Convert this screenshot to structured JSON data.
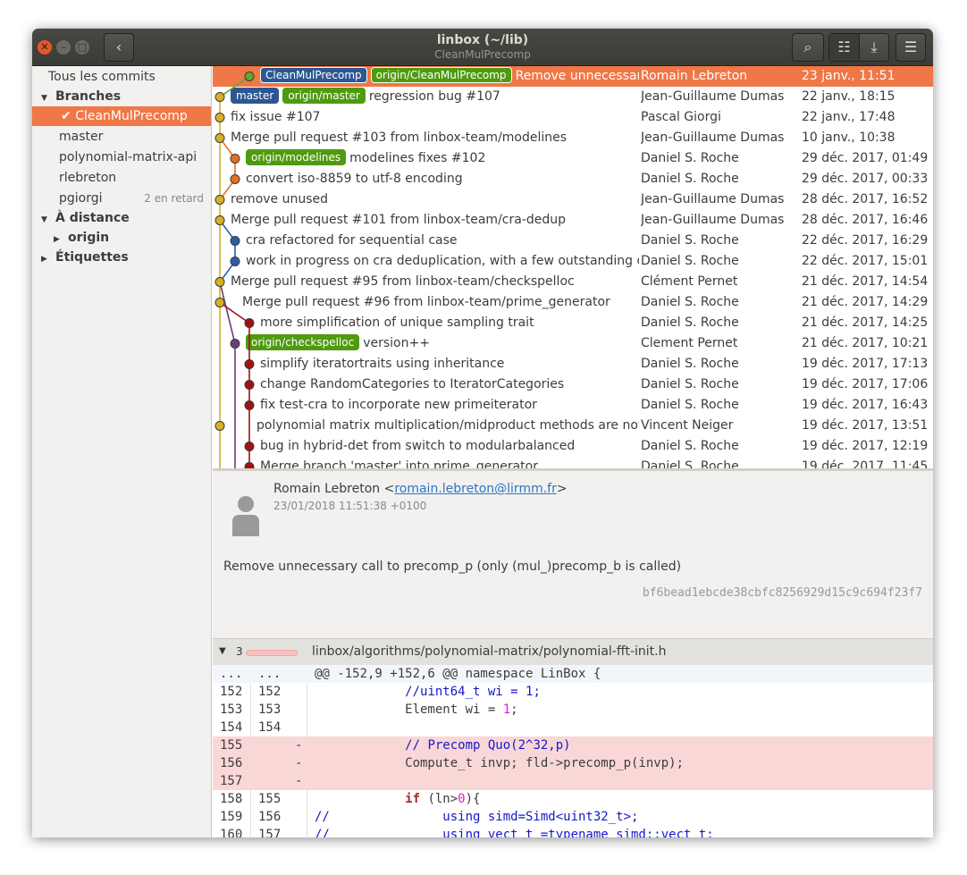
{
  "window": {
    "title": "linbox (~/lib)",
    "subtitle": "CleanMulPrecomp"
  },
  "header": {
    "back_icon": "‹",
    "search_icon": "⌕",
    "list_icon": "☷",
    "download_icon": "⤓",
    "menu_icon": "☰"
  },
  "window_controls": {
    "close": "✕",
    "minimize": "–",
    "maximize": "□"
  },
  "sidebar": {
    "all_commits": "Tous les commits",
    "branches_label": "Branches",
    "branches": [
      {
        "name": "CleanMulPrecomp",
        "check": "✔",
        "selected": true
      },
      {
        "name": "master"
      },
      {
        "name": "polynomial-matrix-api"
      },
      {
        "name": "rlebreton"
      },
      {
        "name": "pgiorgi",
        "badge": "2 en retard"
      }
    ],
    "remote_label": "À distance",
    "remote_items": [
      "origin"
    ],
    "tags_label": "Étiquettes",
    "bottom_a": "±±",
    "bottom_b": "▤"
  },
  "history": [
    {
      "tags": [
        {
          "label": "CleanMulPrecomp",
          "kind": "local"
        },
        {
          "label": "origin/CleanMulPrecomp",
          "kind": "remote"
        }
      ],
      "subject": "Remove unnecessary call to precomp_p (only (mul_)precomp_b is called)",
      "author": "Romain Lebreton",
      "date": "23 janv., 11:51",
      "selected": true,
      "col": 2,
      "color": "#5fa834"
    },
    {
      "tags": [
        {
          "label": "master",
          "kind": "local"
        },
        {
          "label": "origin/master",
          "kind": "remote"
        }
      ],
      "subject": "regression bug #107",
      "author": "Jean-Guillaume Dumas",
      "date": "22 janv., 18:15",
      "col": 0,
      "color": "#d7b023"
    },
    {
      "tags": [],
      "subject": "fix issue #107",
      "author": "Pascal Giorgi",
      "date": "22 janv., 17:48",
      "col": 0,
      "color": "#d7b023"
    },
    {
      "tags": [],
      "subject": "Merge pull request #103 from linbox-team/modelines",
      "author": "Jean-Guillaume Dumas",
      "date": "10 janv., 10:38",
      "col": 0,
      "color": "#d7b023"
    },
    {
      "tags": [
        {
          "label": "origin/modelines",
          "kind": "remote"
        }
      ],
      "subject": "modelines fixes #102",
      "author": "Daniel S. Roche",
      "date": "29 déc. 2017, 01:49",
      "col": 1,
      "color": "#e4701f"
    },
    {
      "tags": [],
      "subject": "convert iso-8859 to utf-8 encoding",
      "author": "Daniel S. Roche",
      "date": "29 déc. 2017, 00:33",
      "col": 1,
      "color": "#e4701f"
    },
    {
      "tags": [],
      "subject": "remove unused",
      "author": "Jean-Guillaume Dumas",
      "date": "28 déc. 2017, 16:52",
      "col": 0,
      "color": "#d7b023"
    },
    {
      "tags": [],
      "subject": "Merge pull request #101 from linbox-team/cra-dedup",
      "author": "Jean-Guillaume Dumas",
      "date": "28 déc. 2017, 16:46",
      "col": 0,
      "color": "#d7b023"
    },
    {
      "tags": [],
      "subject": "cra refactored for sequential case",
      "author": "Daniel S. Roche",
      "date": "22 déc. 2017, 16:29",
      "col": 1,
      "color": "#2a5fa3"
    },
    {
      "tags": [],
      "subject": "work in progress on cra deduplication, with a few outstanding questions",
      "author": "Daniel S. Roche",
      "date": "22 déc. 2017, 15:01",
      "col": 1,
      "color": "#2a5fa3"
    },
    {
      "tags": [],
      "subject": "Merge pull request #95 from linbox-team/checkspelloc",
      "author": "Clément Pernet",
      "date": "21 déc. 2017, 14:54",
      "col": 0,
      "color": "#d7b023"
    },
    {
      "tags": [],
      "subject": "Merge pull request #96 from linbox-team/prime_generator",
      "author": "Daniel S. Roche",
      "date": "21 déc. 2017, 14:29",
      "col": 0,
      "color": "#d7b023",
      "indent": 1
    },
    {
      "tags": [],
      "subject": "more simplification of unique sampling trait",
      "author": "Daniel S. Roche",
      "date": "21 déc. 2017, 14:25",
      "col": 2,
      "color": "#a41010"
    },
    {
      "tags": [
        {
          "label": "origin/checkspelloc",
          "kind": "remote"
        }
      ],
      "subject": "version++",
      "author": "Clement Pernet",
      "date": "21 déc. 2017, 10:21",
      "col": 1,
      "color": "#6d3d7a"
    },
    {
      "tags": [],
      "subject": "simplify iteratortraits using inheritance",
      "author": "Daniel S. Roche",
      "date": "19 déc. 2017, 17:13",
      "col": 2,
      "color": "#a41010"
    },
    {
      "tags": [],
      "subject": "change RandomCategories to IteratorCategories",
      "author": "Daniel S. Roche",
      "date": "19 déc. 2017, 17:06",
      "col": 2,
      "color": "#a41010"
    },
    {
      "tags": [],
      "subject": "fix test-cra to incorporate new primeiterator",
      "author": "Daniel S. Roche",
      "date": "19 déc. 2017, 16:43",
      "col": 2,
      "color": "#a41010"
    },
    {
      "tags": [],
      "subject": "polynomial matrix multiplication/midproduct methods are now static",
      "author": "Vincent Neiger",
      "date": "19 déc. 2017, 13:51",
      "col": 0,
      "color": "#d7b023",
      "indent": 2
    },
    {
      "tags": [],
      "subject": "bug in hybrid-det from switch to modularbalanced",
      "author": "Daniel S. Roche",
      "date": "19 déc. 2017, 12:19",
      "col": 2,
      "color": "#a41010"
    },
    {
      "tags": [],
      "subject": "Merge branch 'master' into prime_generator",
      "author": "Daniel S. Roche",
      "date": "19 déc. 2017, 11:45",
      "col": 2,
      "color": "#a41010"
    }
  ],
  "commit": {
    "author": "Romain Lebreton",
    "email": "romain.lebreton@lirmm.fr",
    "lt": "<",
    "gt": ">",
    "date": "23/01/2018 11:51:38 +0100",
    "message": "Remove unnecessary call to precomp_p (only (mul_)precomp_b is called)",
    "sha": "bf6bead1ebcde38cbfc8256929d15c9c694f23f7"
  },
  "file": {
    "count": "3",
    "path": "linbox/algorithms/polynomial-matrix/polynomial-fft-init.h",
    "arrow": "▼"
  },
  "diff": [
    {
      "o": "...",
      "n": "...",
      "m": "",
      "type": "hunk",
      "parts": [
        [
          "",
          "@@ -152,9 +152,6 @@ namespace LinBox {"
        ]
      ]
    },
    {
      "o": "152",
      "n": "152",
      "m": "",
      "type": "ctx",
      "parts": [
        [
          "",
          "            "
        ],
        [
          "cm",
          "//uint64_t wi = 1;"
        ]
      ]
    },
    {
      "o": "153",
      "n": "153",
      "m": "",
      "type": "ctx",
      "parts": [
        [
          "",
          "            Element wi = "
        ],
        [
          "nm",
          "1"
        ],
        [
          "",
          ";"
        ]
      ]
    },
    {
      "o": "154",
      "n": "154",
      "m": "",
      "type": "ctx",
      "parts": [
        [
          "",
          ""
        ]
      ]
    },
    {
      "o": "155",
      "n": "",
      "m": "-",
      "type": "del",
      "parts": [
        [
          "",
          "            "
        ],
        [
          "cm",
          "// Precomp Quo(2^32,p)"
        ]
      ]
    },
    {
      "o": "156",
      "n": "",
      "m": "-",
      "type": "del",
      "parts": [
        [
          "",
          "            Compute_t invp; fld->precomp_p(invp);"
        ]
      ]
    },
    {
      "o": "157",
      "n": "",
      "m": "-",
      "type": "del",
      "parts": [
        [
          "",
          ""
        ]
      ]
    },
    {
      "o": "158",
      "n": "155",
      "m": "",
      "type": "ctx",
      "parts": [
        [
          "",
          "            "
        ],
        [
          "bo",
          "if"
        ],
        [
          "",
          " (ln>"
        ],
        [
          "nm",
          "0"
        ],
        [
          "",
          "){"
        ]
      ]
    },
    {
      "o": "159",
      "n": "156",
      "m": "",
      "type": "ctx",
      "parts": [
        [
          "cm",
          "//               using simd=Simd<uint32_t>;"
        ]
      ]
    },
    {
      "o": "160",
      "n": "157",
      "m": "",
      "type": "ctx",
      "parts": [
        [
          "cm",
          "//               using vect_t =typename simd::vect_t;"
        ]
      ]
    }
  ]
}
